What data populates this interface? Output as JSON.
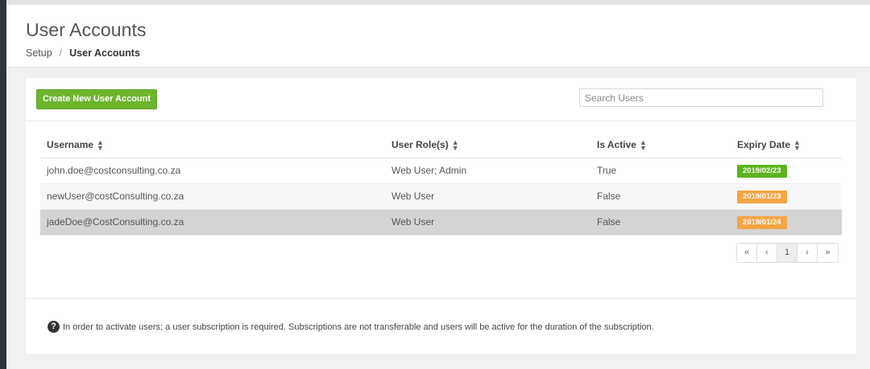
{
  "header": {
    "title": "User Accounts",
    "breadcrumb": {
      "root": "Setup",
      "separator": "/",
      "current": "User Accounts"
    }
  },
  "toolbar": {
    "create_label": "Create New User Account",
    "search_placeholder": "Search Users"
  },
  "table": {
    "columns": [
      "Username",
      "User Role(s)",
      "Is Active",
      "Expiry Date"
    ],
    "rows": [
      {
        "username": "john.doe@costconsulting.co.za",
        "roles": "Web User; Admin",
        "active": "True",
        "expiry": "2019/02/23",
        "expiry_status": "green"
      },
      {
        "username": "newUser@costConsulting.co.za",
        "roles": "Web User",
        "active": "False",
        "expiry": "2019/01/23",
        "expiry_status": "orange"
      },
      {
        "username": "jadeDoe@CostConsulting.co.za",
        "roles": "Web User",
        "active": "False",
        "expiry": "2019/01/24",
        "expiry_status": "orange"
      }
    ]
  },
  "pagination": {
    "first": "«",
    "prev": "‹",
    "page": "1",
    "next": "›",
    "last": "»"
  },
  "footer": {
    "note": "In order to activate users; a user subscription is required. Subscriptions are not transferable and users will be active for the duration of the subscription."
  },
  "colors": {
    "primary_button": "#6cb52d",
    "badge_active": "#5cb41e",
    "badge_expiring": "#f5a443"
  }
}
